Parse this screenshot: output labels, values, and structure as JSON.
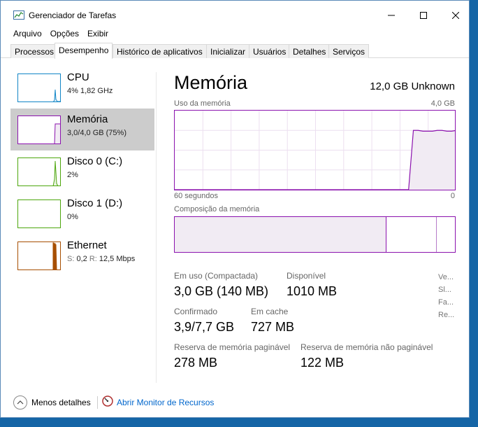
{
  "window": {
    "title": "Gerenciador de Tarefas",
    "icon": "task-manager-icon",
    "controls": [
      "minimize-icon",
      "maximize-icon",
      "close-icon"
    ]
  },
  "menu": [
    "Arquivo",
    "Opções",
    "Exibir"
  ],
  "tabs": [
    {
      "label": "Processos",
      "active": false
    },
    {
      "label": "Desempenho",
      "active": true
    },
    {
      "label": "Histórico de aplicativos",
      "active": false
    },
    {
      "label": "Inicializar",
      "active": false
    },
    {
      "label": "Usuários",
      "active": false
    },
    {
      "label": "Detalhes",
      "active": false
    },
    {
      "label": "Serviços",
      "active": false
    }
  ],
  "sidebar": {
    "items": [
      {
        "name": "CPU",
        "detail": "4% 1,82 GHz",
        "color": "#1185c6",
        "selected": false
      },
      {
        "name": "Memória",
        "detail": "3,0/4,0 GB (75%)",
        "color": "#8b12ae",
        "selected": true
      },
      {
        "name": "Disco 0 (C:)",
        "detail": "2%",
        "color": "#4da60c",
        "selected": false
      },
      {
        "name": "Disco 1 (D:)",
        "detail": "0%",
        "color": "#4da60c",
        "selected": false
      },
      {
        "name": "Ethernet",
        "detail_prefix_s": "S:",
        "detail_s": "0,2",
        "detail_prefix_r": "R:",
        "detail_r": "12,5 Mbps",
        "color": "#a74f01",
        "selected": false
      }
    ]
  },
  "main": {
    "title": "Memória",
    "total": "12,0 GB Unknown",
    "usage_label": "Uso da memória",
    "usage_max": "4,0 GB",
    "time_left": "60 segundos",
    "time_right": "0",
    "composition_label": "Composição da memória",
    "stats": {
      "in_use_label": "Em uso (Compactada)",
      "in_use_value": "3,0 GB (140 MB)",
      "available_label": "Disponível",
      "available_value": "1010 MB",
      "committed_label": "Confirmado",
      "committed_value": "3,9/7,7 GB",
      "cached_label": "Em cache",
      "cached_value": "727 MB",
      "paged_label": "Reserva de memória paginável",
      "paged_value": "278 MB",
      "nonpaged_label": "Reserva de memória não paginável",
      "nonpaged_value": "122 MB"
    },
    "side_labels": [
      "Ve...",
      "Sl...",
      "Fa...",
      "Re..."
    ]
  },
  "footer": {
    "fewer_details": "Menos detalhes",
    "resource_monitor": "Abrir Monitor de Recursos"
  },
  "colors": {
    "memory": "#8b12ae",
    "cpu": "#1185c6",
    "disk": "#4da60c",
    "ethernet": "#a74f01",
    "link": "#0066cc"
  },
  "chart_data": {
    "type": "area",
    "title": "Uso da memória",
    "xlabel": "",
    "ylabel": "",
    "x_range_seconds": [
      60,
      0
    ],
    "ylim_gb": [
      0,
      4.0
    ],
    "grid": true,
    "series": [
      {
        "values_fraction": [
          0,
          0,
          0,
          0,
          0,
          0,
          0,
          0,
          0,
          0,
          0,
          0,
          0,
          0,
          0,
          0,
          0,
          0,
          0,
          0,
          0,
          0,
          0,
          0,
          0,
          0,
          0,
          0,
          0,
          0,
          0,
          0,
          0,
          0,
          0,
          0,
          0,
          0,
          0,
          0,
          0,
          0,
          0,
          0,
          0,
          0,
          0,
          0,
          0,
          0,
          0.75,
          0.75,
          0.74,
          0.74,
          0.74,
          0.75,
          0.75,
          0.74,
          0.74,
          0.75
        ]
      }
    ],
    "composition": {
      "in_use_fraction": 0.75,
      "modified_fraction": 0.0,
      "standby_fraction": 0.18,
      "free_fraction": 0.07
    }
  }
}
